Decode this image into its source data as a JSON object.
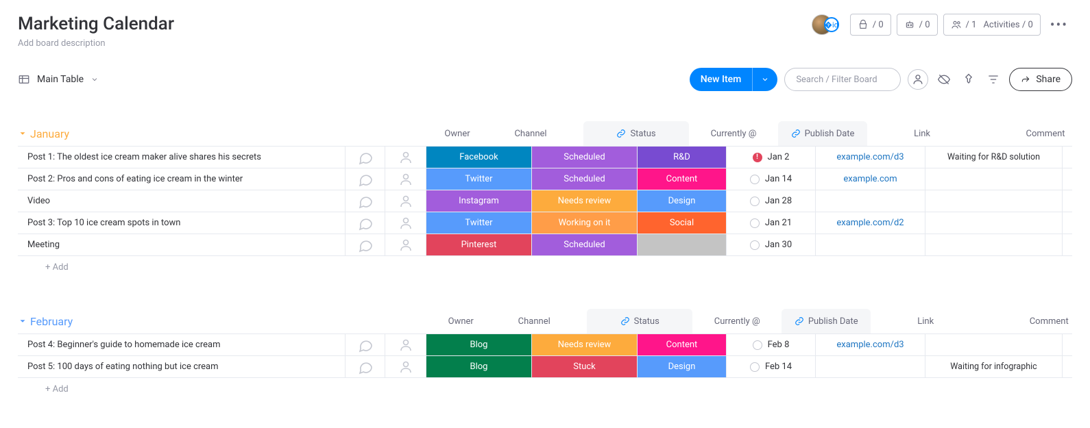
{
  "header": {
    "title": "Marketing Calendar",
    "subtitle_placeholder": "Add board description",
    "integrations_count": "/ 0",
    "automations_count": "/ 0",
    "members_count": "/ 1",
    "activities_label": "Activities / 0"
  },
  "toolbar": {
    "view_name": "Main Table",
    "new_item_label": "New Item",
    "search_placeholder": "Search / Filter Board",
    "share_label": "Share"
  },
  "columns": {
    "owner": "Owner",
    "channel": "Channel",
    "status": "Status",
    "currently": "Currently @",
    "publish_date": "Publish Date",
    "link": "Link",
    "comment": "Comment"
  },
  "add_row_label": "+ Add",
  "colors": {
    "january": "#fdab3d",
    "february": "#579bfc",
    "channel": {
      "Facebook": "#0086c0",
      "Twitter": "#579bfc",
      "Instagram": "#a25ddc",
      "Pinterest": "#e2445c",
      "Blog": "#037f4c"
    },
    "status": {
      "Scheduled": "#a25ddc",
      "Needs review": "#fdab3d",
      "Working on it": "#ff9d48",
      "Stuck": "#e2445c"
    },
    "currently": {
      "R&D": "#784bd1",
      "Content": "#ff158a",
      "Design": "#579bfc",
      "Social": "#ff642e",
      "": "#c4c4c4"
    }
  },
  "groups": [
    {
      "name": "January",
      "color_key": "january",
      "rows": [
        {
          "name": "Post 1: The oldest ice cream maker alive shares his secrets",
          "channel": "Facebook",
          "status": "Scheduled",
          "currently": "R&D",
          "date": "Jan 2",
          "date_alert": true,
          "link": "example.com/d3",
          "comment": "Waiting for R&D solution"
        },
        {
          "name": "Post 2: Pros and cons of eating ice cream in the winter",
          "channel": "Twitter",
          "status": "Scheduled",
          "currently": "Content",
          "date": "Jan 14",
          "date_alert": false,
          "link": "example.com",
          "comment": ""
        },
        {
          "name": "Video",
          "channel": "Instagram",
          "status": "Needs review",
          "currently": "Design",
          "date": "Jan 28",
          "date_alert": false,
          "link": "",
          "comment": ""
        },
        {
          "name": "Post 3: Top 10 ice cream spots in town",
          "channel": "Twitter",
          "status": "Working on it",
          "currently": "Social",
          "date": "Jan 21",
          "date_alert": false,
          "link": "example.com/d2",
          "comment": ""
        },
        {
          "name": "Meeting",
          "channel": "Pinterest",
          "status": "Scheduled",
          "currently": "",
          "date": "Jan 30",
          "date_alert": false,
          "link": "",
          "comment": ""
        }
      ]
    },
    {
      "name": "February",
      "color_key": "february",
      "rows": [
        {
          "name": "Post 4: Beginner's guide to homemade ice cream",
          "channel": "Blog",
          "status": "Needs review",
          "currently": "Content",
          "date": "Feb 8",
          "date_alert": false,
          "link": "example.com/d3",
          "comment": ""
        },
        {
          "name": "Post 5: 100 days of eating nothing but ice cream",
          "channel": "Blog",
          "status": "Stuck",
          "currently": "Design",
          "date": "Feb 14",
          "date_alert": false,
          "link": "",
          "comment": "Waiting for infographic"
        }
      ]
    }
  ]
}
